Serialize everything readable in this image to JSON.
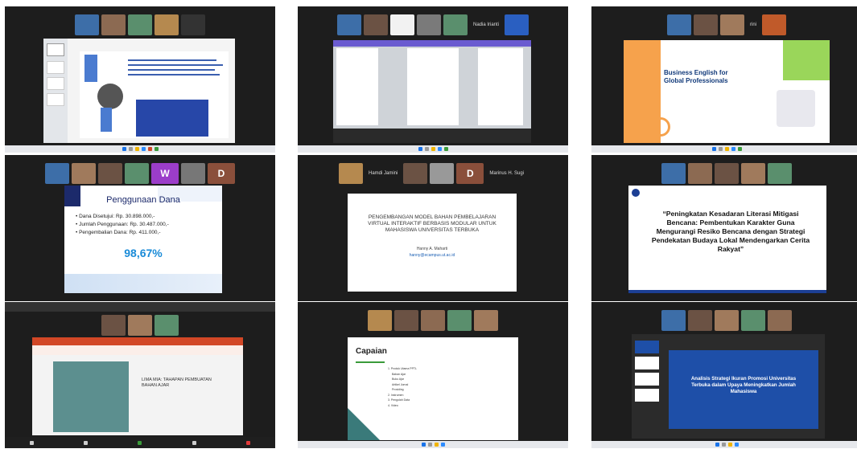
{
  "tiles": [
    {
      "participant": "",
      "slide_text": ""
    },
    {
      "participant": "Nadia Irianti",
      "slide_text": ""
    },
    {
      "participant": "rini",
      "title": "Business English for Global Professionals"
    },
    {
      "badges": [
        "W",
        "D"
      ],
      "title": "Penggunaan Dana",
      "bullets": [
        "Dana Disetujui: Rp. 30.898.000,-",
        "Jumlah Penggunaan: Rp. 30.487.000,-",
        "Pengembalian Dana: Rp. 411.000,-"
      ],
      "percent": "98,67%"
    },
    {
      "participants": [
        "Hamdi Jamini",
        "Marinus H. Sugi"
      ],
      "badge": "D",
      "title": "PENGEMBANGAN MODEL BAHAN PEMBELAJARAN VIRTUAL INTERAKTIF BERBASIS MODULAR UNTUK MAHASISWA UNIVERSITAS TERBUKA",
      "author": "Hanny A. Maharti",
      "email": "hanny@ecampus.ut.ac.id"
    },
    {
      "title": "“Peningkatan Kesadaran Literasi Mitigasi Bencana: Pembentukan Karakter Guna Mengurangi Resiko Bencana dengan Strategi Pendekatan Budaya Lokal Mendengarkan Cerita Rakyat”"
    },
    {
      "title": "LIMA MIA: TAHAPAN PEMBUATAN BAHAN AJAR"
    },
    {
      "title": "Capaian",
      "items": [
        "1. Produk Utama PPTL",
        "Bahan Ajar",
        "Buku Ajar",
        "Artikel Jurnal",
        "Prosiding",
        "2. Instrumen",
        "3. Pengolah Data",
        "4. Video"
      ]
    },
    {
      "title": "Analisis Strategi Ikuran Promosi Universitas Terbuka dalam Upaya Meningkatkan Jumlah Mahasiswa"
    }
  ],
  "colors": {
    "accent_green": "#3a9b3a",
    "badge_purple": "#9b3dc9",
    "badge_brown": "#8a4f3b",
    "percent_blue": "#1a8bd8"
  }
}
